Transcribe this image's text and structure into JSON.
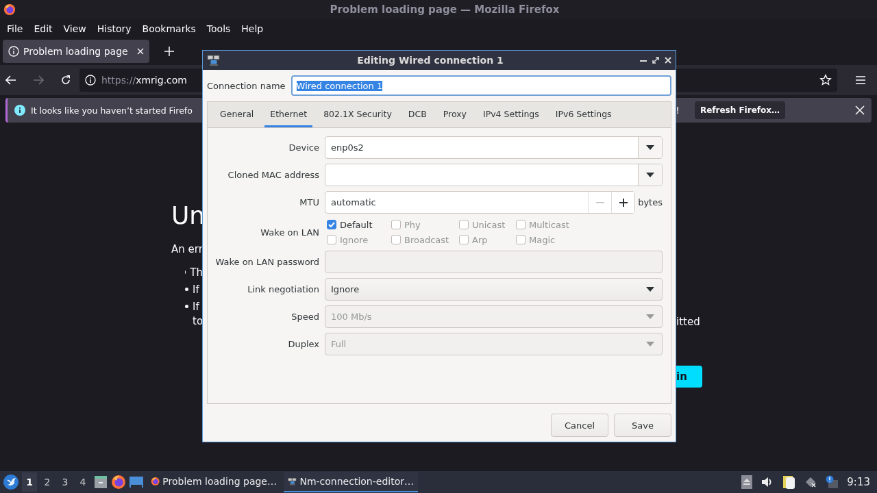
{
  "window": {
    "title": "Problem loading page — Mozilla Firefox"
  },
  "menu": [
    "File",
    "Edit",
    "View",
    "History",
    "Bookmarks",
    "Tools",
    "Help"
  ],
  "tabs": [
    {
      "title": "Problem loading page",
      "selected": true
    }
  ],
  "nav": {
    "scheme": "https://",
    "host": "xmrig.com"
  },
  "notification": {
    "text": "It looks like you haven’t started Firefo",
    "tail": "!",
    "button": "Refresh Firefox…"
  },
  "page": {
    "heading": "Un",
    "intro": "An err",
    "bullets": [
      {
        "left": "Th"
      },
      {
        "left": "If"
      },
      {
        "left": "If",
        "right": "itted",
        "cont": "to"
      }
    ],
    "button": "in"
  },
  "dialog": {
    "title": "Editing Wired connection 1",
    "name_label": "Connection name",
    "name_value": "Wired connection 1",
    "tabs": [
      {
        "label": "General",
        "selected": false
      },
      {
        "label": "Ethernet",
        "selected": true
      },
      {
        "label": "802.1X Security",
        "selected": false
      },
      {
        "label": "DCB",
        "selected": false
      },
      {
        "label": "Proxy",
        "selected": false
      },
      {
        "label": "IPv4 Settings",
        "selected": false
      },
      {
        "label": "IPv6 Settings",
        "selected": false
      }
    ],
    "rows": [
      {
        "kind": "combo-entry",
        "label": "Device",
        "value": "enp0s2",
        "disabled": false
      },
      {
        "kind": "combo-entry",
        "label": "Cloned MAC address",
        "disabled": false
      },
      {
        "kind": "spin",
        "label": "MTU",
        "value": "automatic",
        "unit": "bytes",
        "disabled": false
      },
      {
        "kind": "checks",
        "label": "Wake on LAN",
        "checks": [
          {
            "label": "Default",
            "checked": true,
            "disabled": false
          },
          {
            "label": "Phy",
            "checked": false,
            "disabled": true
          },
          {
            "label": "Unicast",
            "checked": false,
            "disabled": true
          },
          {
            "label": "Multicast",
            "checked": false,
            "disabled": true
          },
          {
            "label": "Ignore",
            "checked": false,
            "disabled": true
          },
          {
            "label": "Broadcast",
            "checked": false,
            "disabled": true
          },
          {
            "label": "Arp",
            "checked": false,
            "disabled": true
          },
          {
            "label": "Magic",
            "checked": false,
            "disabled": true
          }
        ]
      },
      {
        "kind": "entry",
        "label": "Wake on LAN password",
        "disabled": true
      },
      {
        "kind": "combo",
        "label": "Link negotiation",
        "value": "Ignore",
        "disabled": false
      },
      {
        "kind": "combo",
        "label": "Speed",
        "value": "100 Mb/s",
        "disabled": true
      },
      {
        "kind": "combo",
        "label": "Duplex",
        "value": "Full",
        "disabled": true
      }
    ],
    "buttons": [
      "Cancel",
      "Save"
    ]
  },
  "taskbar": {
    "workspaces": [
      {
        "label": "1",
        "selected": true
      },
      {
        "label": "2",
        "selected": false
      },
      {
        "label": "3",
        "selected": false
      },
      {
        "label": "4",
        "selected": false
      }
    ],
    "tasks": [
      {
        "title": "Problem loading page…",
        "kind": "browser",
        "selected": false
      },
      {
        "title": "Nm-connection-editor…",
        "kind": "network",
        "selected": true
      }
    ],
    "clock": "9:13"
  }
}
